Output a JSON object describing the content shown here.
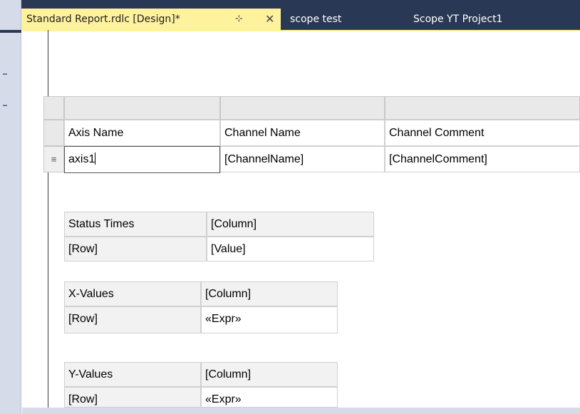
{
  "tabs": [
    {
      "label": "Standard Report.rdlc [Design]*",
      "active": true
    },
    {
      "label": "scope test",
      "active": false
    },
    {
      "label": "Scope YT Project1",
      "active": false
    }
  ],
  "tab_icons": {
    "pin": "⊹",
    "close": "✕"
  },
  "tablix_main": {
    "headers": [
      "Axis Name",
      "Channel Name",
      "Channel Comment"
    ],
    "row_handle": "≡",
    "row": [
      "axis1",
      "[ChannelName]",
      "[ChannelComment]"
    ]
  },
  "matrices": [
    {
      "corner": "Status Times",
      "column": "[Column]",
      "row": "[Row]",
      "value": "[Value]"
    },
    {
      "corner": "X-Values",
      "column": "[Column]",
      "row": "[Row]",
      "value": "«Expr»"
    },
    {
      "corner": "Y-Values",
      "column": "[Column]",
      "row": "[Row]",
      "value": "«Expr»"
    }
  ],
  "colors": {
    "tab_active_bg": "#fff29d",
    "frame_bg": "#293955"
  }
}
